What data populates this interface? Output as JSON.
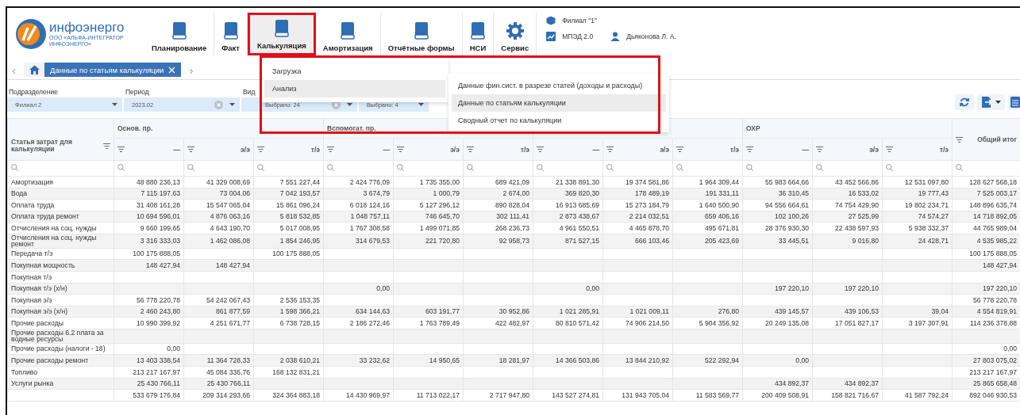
{
  "header": {
    "logo": {
      "name": "инфоэнерго",
      "subtitle": "ООО «АЛЬФА-ИНТЕГРАТОР ИНФОЭНЕРГО»"
    },
    "nav": [
      {
        "label": "Планирование",
        "selected": false,
        "highlighted": false
      },
      {
        "label": "Факт",
        "selected": false,
        "highlighted": false
      },
      {
        "label": "Калькуляция",
        "selected": true,
        "highlighted": true
      },
      {
        "label": "Амортизация",
        "selected": false,
        "highlighted": false
      },
      {
        "label": "Отчётные формы",
        "selected": false,
        "highlighted": false
      },
      {
        "label": "НСИ",
        "selected": false,
        "highlighted": false
      },
      {
        "label": "Сервис",
        "selected": false,
        "highlighted": false
      }
    ],
    "info": {
      "branch": "Филиал \"1\"",
      "app": "МПЭД 2.0",
      "user": "Дьяконова Л. А."
    }
  },
  "tab_scroll": {
    "prev": "‹",
    "next": "›"
  },
  "tabs": [
    {
      "label": "Данные по статьям калькуляции",
      "selected": true
    }
  ],
  "filters": [
    {
      "label": "Подразделение",
      "value": "Филиал 2",
      "clearable": false
    },
    {
      "label": "Период",
      "value": "2023.02",
      "clearable": true
    },
    {
      "label": "Вид",
      "value": "Выбрано: 24",
      "clearable": true
    },
    {
      "value": "Выбрано: 4",
      "clearable": false
    }
  ],
  "menu": {
    "highlighted": true,
    "items": [
      {
        "label": "Загрузка",
        "selected": false
      },
      {
        "label": "Анализ",
        "selected": true
      }
    ],
    "submenu": [
      {
        "label": "Данные фин.сист. в разрезе статей (доходы и расходы)",
        "selected": false
      },
      {
        "label": "Данные по статьям калькуляции",
        "selected": true
      },
      {
        "label": "Сводный отчет по калькуляции",
        "selected": false
      }
    ]
  },
  "table": {
    "first_header": "Статья затрат для калькуляции",
    "total_header": "Общий итог",
    "groups": [
      {
        "label": "Основ. пр.",
        "columns": [
          "—",
          "э/э",
          "т/э"
        ]
      },
      {
        "label": "Вспомогат. пр.",
        "columns": [
          "—",
          "э/э",
          "т/э"
        ]
      },
      {
        "columns": [
          "—",
          "э/э",
          "т/э"
        ]
      },
      {
        "label": "ОХР",
        "columns": [
          "—",
          "э/э",
          "т/э"
        ]
      }
    ],
    "rows": [
      {
        "label": "Амортизация",
        "col_1": "48 880 236,13",
        "col_2": "41 329 008,69",
        "col_3": "7 551 227,44",
        "col_4": "2 424 776,09",
        "col_5": "1 735 355,00",
        "col_6": "689 421,09",
        "col_7": "21 338 891,30",
        "col_8": "19 374 581,86",
        "col_9": "1 964 309,44",
        "col_10": "55 983 664,66",
        "col_11": "43 452 566,86",
        "col_12": "12 531 097,80",
        "total": "128 627 568,18"
      },
      {
        "label": "Вода",
        "col_1": "7 115 197,63",
        "col_2": "73 004,06",
        "col_3": "7 042 193,57",
        "col_4": "3 674,79",
        "col_5": "1 000,79",
        "col_6": "2 674,00",
        "col_7": "369 820,30",
        "col_8": "178 489,19",
        "col_9": "191 331,11",
        "col_10": "36 310,45",
        "col_11": "16 533,02",
        "col_12": "19 777,43",
        "total": "7 525 003,17"
      },
      {
        "label": "Оплата труда",
        "col_1": "31 408 161,28",
        "col_2": "15 547 065,04",
        "col_3": "15 861 096,24",
        "col_4": "6 018 124,16",
        "col_5": "5 127 296,12",
        "col_6": "890 828,04",
        "col_7": "16 913 685,69",
        "col_8": "15 273 184,79",
        "col_9": "1 640 500,90",
        "col_10": "94 556 664,61",
        "col_11": "74 754 429,90",
        "col_12": "19 802 234,71",
        "total": "148 896 635,74"
      },
      {
        "label": "Оплата труда ремонт",
        "col_1": "10 694 596,01",
        "col_2": "4 876 063,16",
        "col_3": "5 818 532,85",
        "col_4": "1 048 757,11",
        "col_5": "746 645,70",
        "col_6": "302 111,41",
        "col_7": "2 873 438,67",
        "col_8": "2 214 032,51",
        "col_9": "659 406,16",
        "col_10": "102 100,26",
        "col_11": "27 525,99",
        "col_12": "74 574,27",
        "total": "14 718 892,05"
      },
      {
        "label": "Отчисления на соц. нужды",
        "col_1": "9 660 199,65",
        "col_2": "4 643 190,70",
        "col_3": "5 017 008,95",
        "col_4": "1 767 308,58",
        "col_5": "1 499 071,85",
        "col_6": "268 236,73",
        "col_7": "4 961 550,51",
        "col_8": "4 465 878,70",
        "col_9": "495 671,81",
        "col_10": "28 376 930,30",
        "col_11": "22 438 597,93",
        "col_12": "5 938 332,37",
        "total": "44 765 989,04"
      },
      {
        "label": "Отчисления на соц. нужды ремонт",
        "col_1": "3 316 333,03",
        "col_2": "1 462 086,08",
        "col_3": "1 854 246,95",
        "col_4": "314 679,53",
        "col_5": "221 720,80",
        "col_6": "92 958,73",
        "col_7": "871 527,15",
        "col_8": "666 103,46",
        "col_9": "205 423,69",
        "col_10": "33 445,51",
        "col_11": "9 016,80",
        "col_12": "24 428,71",
        "total": "4 535 985,22"
      },
      {
        "label": "Передача т/э",
        "col_1": "100 175 888,05",
        "col_3": "100 175 888,05",
        "total": "100 175 888,05"
      },
      {
        "label": "Покупная мощность",
        "col_1": "148 427,94",
        "col_2": "148 427,94",
        "total": "148 427,94"
      },
      {
        "label": "Покупная т/э"
      },
      {
        "label": "Покупная т/э (х/н)",
        "col_4": "0,00",
        "col_7": "0,00",
        "col_10": "197 220,10",
        "col_11": "197 220,10",
        "total": "197 220,10"
      },
      {
        "label": "Покупная э/э",
        "col_1": "56 778 220,78",
        "col_2": "54 242 067,43",
        "col_3": "2 536 153,35",
        "total": "56 778 220,78"
      },
      {
        "label": "Покупная э/э (х/н)",
        "col_1": "2 460 243,80",
        "col_2": "861 877,59",
        "col_3": "1 598 366,21",
        "col_4": "634 144,63",
        "col_5": "603 191,77",
        "col_6": "30 952,86",
        "col_7": "1 021 285,91",
        "col_8": "1 021 009,11",
        "col_9": "276,80",
        "col_10": "439 145,57",
        "col_11": "439 106,53",
        "col_12": "39,04",
        "total": "4 554 819,91"
      },
      {
        "label": "Прочие расходы",
        "col_1": "10 990 399,92",
        "col_2": "4 251 671,77",
        "col_3": "6 738 728,15",
        "col_4": "2 186 272,46",
        "col_5": "1 763 789,49",
        "col_6": "422 482,97",
        "col_7": "80 810 571,42",
        "col_8": "74 906 214,50",
        "col_9": "5 904 356,92",
        "col_10": "20 249 135,08",
        "col_11": "17 051 827,17",
        "col_12": "3 197 307,91",
        "total": "114 236 378,88"
      },
      {
        "label": "Прочие расходы 6.2 плата за водные ресурсы"
      },
      {
        "label": "Прочие расходы (налоги - 18)",
        "col_1": "0,00",
        "total": "0,00"
      },
      {
        "label": "Прочие расходы ремонт",
        "col_1": "13 403 338,54",
        "col_2": "11 364 728,33",
        "col_3": "2 038 610,21",
        "col_4": "33 232,62",
        "col_5": "14 950,65",
        "col_6": "18 281,97",
        "col_7": "14 366 503,86",
        "col_8": "13 844 210,92",
        "col_9": "522 292,94",
        "col_10": "0,00",
        "total": "27 803 075,02"
      },
      {
        "label": "Топливо",
        "col_1": "213 217 167,97",
        "col_2": "45 084 336,76",
        "col_3": "168 132 831,21",
        "total": "213 217 167,97"
      },
      {
        "label": "Услуги рынка",
        "col_1": "25 430 766,11",
        "col_2": "25 430 766,11",
        "col_10": "434 892,37",
        "col_11": "434 892,37",
        "total": "25 865 658,48"
      },
      {
        "col_1": "533 679 176,84",
        "col_2": "209 314 293,66",
        "col_3": "324 364 883,18",
        "col_4": "14 430 969,97",
        "col_5": "11 713 022,17",
        "col_6": "2 717 947,80",
        "col_7": "143 527 274,81",
        "col_8": "131 943 705,04",
        "col_9": "11 583 569,77",
        "col_10": "200 409 508,91",
        "col_11": "158 821 716,67",
        "col_12": "41 587 792,24",
        "total": "892 046 930,53"
      }
    ]
  }
}
